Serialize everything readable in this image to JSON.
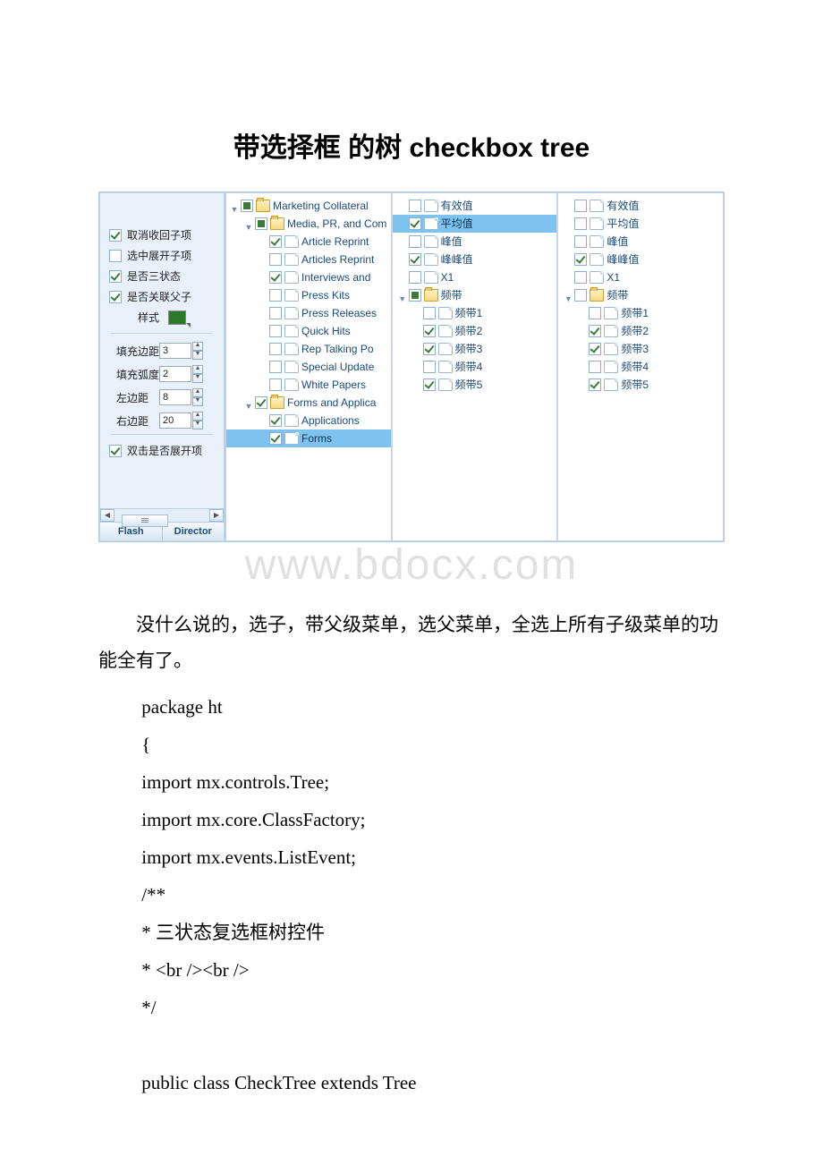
{
  "title": "带选择框 的树 checkbox tree",
  "watermark": "www.bdocx.com",
  "sidebar": {
    "opts": [
      {
        "label": "取消收回子项",
        "checked": true
      },
      {
        "label": "选中展开子项",
        "checked": false
      },
      {
        "label": "是否三状态",
        "checked": true
      },
      {
        "label": "是否关联父子",
        "checked": true
      }
    ],
    "style_label": "样式",
    "nums": [
      {
        "label": "填充边距",
        "value": "3"
      },
      {
        "label": "填充弧度",
        "value": "2"
      },
      {
        "label": "左边距",
        "value": "8"
      },
      {
        "label": "右边距",
        "value": "20"
      }
    ],
    "dblclick": {
      "label": "双击是否展开项",
      "checked": true
    },
    "tabs": [
      "Flash",
      "Director"
    ]
  },
  "tree1": [
    {
      "d": 0,
      "tw": "▼",
      "cb": "mixb",
      "ico": "folder open",
      "t": "Marketing Collateral"
    },
    {
      "d": 1,
      "tw": "▼",
      "cb": "mixb",
      "ico": "folder open",
      "t": "Media, PR, and Com"
    },
    {
      "d": 2,
      "tw": "",
      "cb": "chk",
      "ico": "file",
      "t": "Article Reprint"
    },
    {
      "d": 2,
      "tw": "",
      "cb": "",
      "ico": "file",
      "t": "Articles Reprint"
    },
    {
      "d": 2,
      "tw": "",
      "cb": "chk",
      "ico": "file",
      "t": "Interviews and"
    },
    {
      "d": 2,
      "tw": "",
      "cb": "",
      "ico": "file",
      "t": "Press Kits"
    },
    {
      "d": 2,
      "tw": "",
      "cb": "",
      "ico": "file",
      "t": "Press Releases"
    },
    {
      "d": 2,
      "tw": "",
      "cb": "",
      "ico": "file",
      "t": "Quick Hits"
    },
    {
      "d": 2,
      "tw": "",
      "cb": "",
      "ico": "file",
      "t": "Rep Talking Po"
    },
    {
      "d": 2,
      "tw": "",
      "cb": "",
      "ico": "file",
      "t": "Special Update"
    },
    {
      "d": 2,
      "tw": "",
      "cb": "",
      "ico": "file",
      "t": "White Papers"
    },
    {
      "d": 1,
      "tw": "▼",
      "cb": "chk",
      "ico": "folder open",
      "t": "Forms and Applica"
    },
    {
      "d": 2,
      "tw": "",
      "cb": "chk",
      "ico": "file",
      "t": "Applications"
    },
    {
      "d": 2,
      "tw": "",
      "cb": "chk",
      "ico": "file",
      "t": "Forms",
      "sel": true
    }
  ],
  "tree2": [
    {
      "d": 0,
      "tw": "",
      "cb": "",
      "ico": "file",
      "t": "有效值"
    },
    {
      "d": 0,
      "tw": "",
      "cb": "chk",
      "ico": "file",
      "t": "平均值",
      "sel": true
    },
    {
      "d": 0,
      "tw": "",
      "cb": "",
      "ico": "file",
      "t": "峰值"
    },
    {
      "d": 0,
      "tw": "",
      "cb": "chk",
      "ico": "file",
      "t": "峰峰值"
    },
    {
      "d": 0,
      "tw": "",
      "cb": "",
      "ico": "file",
      "t": "X1"
    },
    {
      "d": 0,
      "tw": "▼",
      "cb": "mixb",
      "ico": "folder open",
      "t": "频带"
    },
    {
      "d": 1,
      "tw": "",
      "cb": "",
      "ico": "file",
      "t": "频带1"
    },
    {
      "d": 1,
      "tw": "",
      "cb": "chk",
      "ico": "file",
      "t": "频带2"
    },
    {
      "d": 1,
      "tw": "",
      "cb": "chk",
      "ico": "file",
      "t": "频带3"
    },
    {
      "d": 1,
      "tw": "",
      "cb": "",
      "ico": "file",
      "t": "频带4"
    },
    {
      "d": 1,
      "tw": "",
      "cb": "chk",
      "ico": "file",
      "t": "频带5"
    }
  ],
  "tree3": [
    {
      "d": 0,
      "tw": "",
      "cb": "",
      "ico": "file",
      "t": "有效值"
    },
    {
      "d": 0,
      "tw": "",
      "cb": "",
      "ico": "file",
      "t": "平均值"
    },
    {
      "d": 0,
      "tw": "",
      "cb": "",
      "ico": "file",
      "t": "峰值"
    },
    {
      "d": 0,
      "tw": "",
      "cb": "chk",
      "ico": "file",
      "t": "峰峰值"
    },
    {
      "d": 0,
      "tw": "",
      "cb": "",
      "ico": "file",
      "t": "X1"
    },
    {
      "d": 0,
      "tw": "▼",
      "cb": "",
      "ico": "folder open",
      "t": "频带"
    },
    {
      "d": 1,
      "tw": "",
      "cb": "",
      "ico": "file",
      "t": "频带1"
    },
    {
      "d": 1,
      "tw": "",
      "cb": "chk",
      "ico": "file",
      "t": "频带2"
    },
    {
      "d": 1,
      "tw": "",
      "cb": "chk",
      "ico": "file",
      "t": "频带3"
    },
    {
      "d": 1,
      "tw": "",
      "cb": "",
      "ico": "file",
      "t": "频带4"
    },
    {
      "d": 1,
      "tw": "",
      "cb": "chk",
      "ico": "file",
      "t": "频带5"
    }
  ],
  "para": "没什么说的，选子，带父级菜单，选父菜单，全选上所有子级菜单的功能全有了。",
  "code": [
    "package ht",
    "{",
    " import mx.controls.Tree;",
    " import mx.core.ClassFactory;",
    " import mx.events.ListEvent;",
    " /**",
    " * 三状态复选框树控件",
    " * <br /><br />",
    " */",
    "",
    " public class CheckTree extends Tree"
  ]
}
